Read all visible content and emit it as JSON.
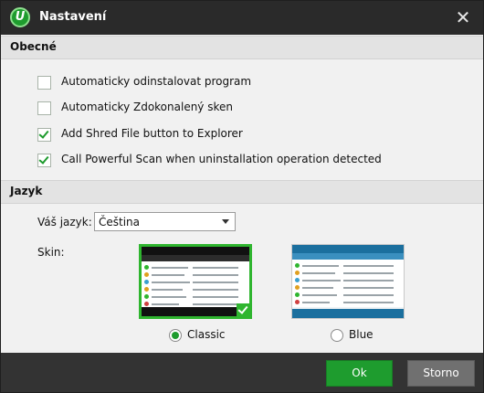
{
  "window": {
    "title": "Nastavení",
    "logo_text": "U"
  },
  "sections": {
    "general": "Obecné",
    "language": "Jazyk"
  },
  "options": [
    {
      "label": "Automaticky odinstalovat program",
      "checked": false
    },
    {
      "label": "Automaticky Zdokonalený sken",
      "checked": false
    },
    {
      "label": "Add Shred File button to Explorer",
      "checked": true
    },
    {
      "label": "Call Powerful Scan when uninstallation operation detected",
      "checked": true
    }
  ],
  "language": {
    "label": "Váš jazyk:",
    "selected": "Čeština"
  },
  "skin": {
    "label": "Skin:",
    "options": [
      {
        "name": "Classic",
        "selected": true
      },
      {
        "name": "Blue",
        "selected": false
      }
    ]
  },
  "buttons": {
    "ok": "Ok",
    "cancel": "Storno"
  },
  "colors": {
    "accent": "#1e9c2e",
    "titlebar": "#2a2a2a",
    "footer": "#333333"
  }
}
